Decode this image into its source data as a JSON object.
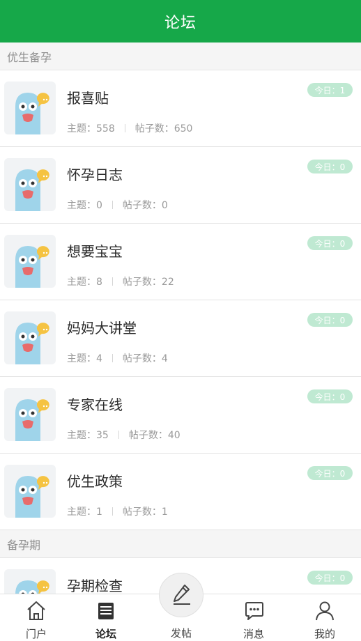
{
  "header": {
    "title": "论坛"
  },
  "sections": [
    {
      "title": "优生备孕"
    },
    {
      "title": "备孕期"
    }
  ],
  "labels": {
    "topics_prefix": "主题：",
    "posts_prefix": "帖子数：",
    "today_prefix": "今日："
  },
  "forums": [
    {
      "name": "报喜贴",
      "topics": "558",
      "posts": "650",
      "today": "1",
      "topics_text": "主题：558",
      "posts_text": "帖子数：650",
      "today_text": "今日：1"
    },
    {
      "name": "怀孕日志",
      "topics": "0",
      "posts": "0",
      "today": "0",
      "topics_text": "主题：0",
      "posts_text": "帖子数：0",
      "today_text": "今日：0"
    },
    {
      "name": "想要宝宝",
      "topics": "8",
      "posts": "22",
      "today": "0",
      "topics_text": "主题：8",
      "posts_text": "帖子数：22",
      "today_text": "今日：0"
    },
    {
      "name": "妈妈大讲堂",
      "topics": "4",
      "posts": "4",
      "today": "0",
      "topics_text": "主题：4",
      "posts_text": "帖子数：4",
      "today_text": "今日：0"
    },
    {
      "name": "专家在线",
      "topics": "35",
      "posts": "40",
      "today": "0",
      "topics_text": "主题：35",
      "posts_text": "帖子数：40",
      "today_text": "今日：0"
    },
    {
      "name": "优生政策",
      "topics": "1",
      "posts": "1",
      "today": "0",
      "topics_text": "主题：1",
      "posts_text": "帖子数：1",
      "today_text": "今日：0"
    },
    {
      "name": "孕期检查",
      "today": "0",
      "today_text": "今日：0"
    }
  ],
  "tabbar": {
    "portal": {
      "label": "门户",
      "icon": "home-icon"
    },
    "forum": {
      "label": "论坛",
      "icon": "book-icon"
    },
    "post": {
      "label": "发帖",
      "icon": "pen-icon"
    },
    "messages": {
      "label": "消息",
      "icon": "chat-bubble-icon"
    },
    "mine": {
      "label": "我的",
      "icon": "person-icon"
    }
  },
  "colors": {
    "brand": "#16a849",
    "badge": "#bfe9d2",
    "mascot": "#9fd4ea",
    "speech": "#f5c342"
  }
}
